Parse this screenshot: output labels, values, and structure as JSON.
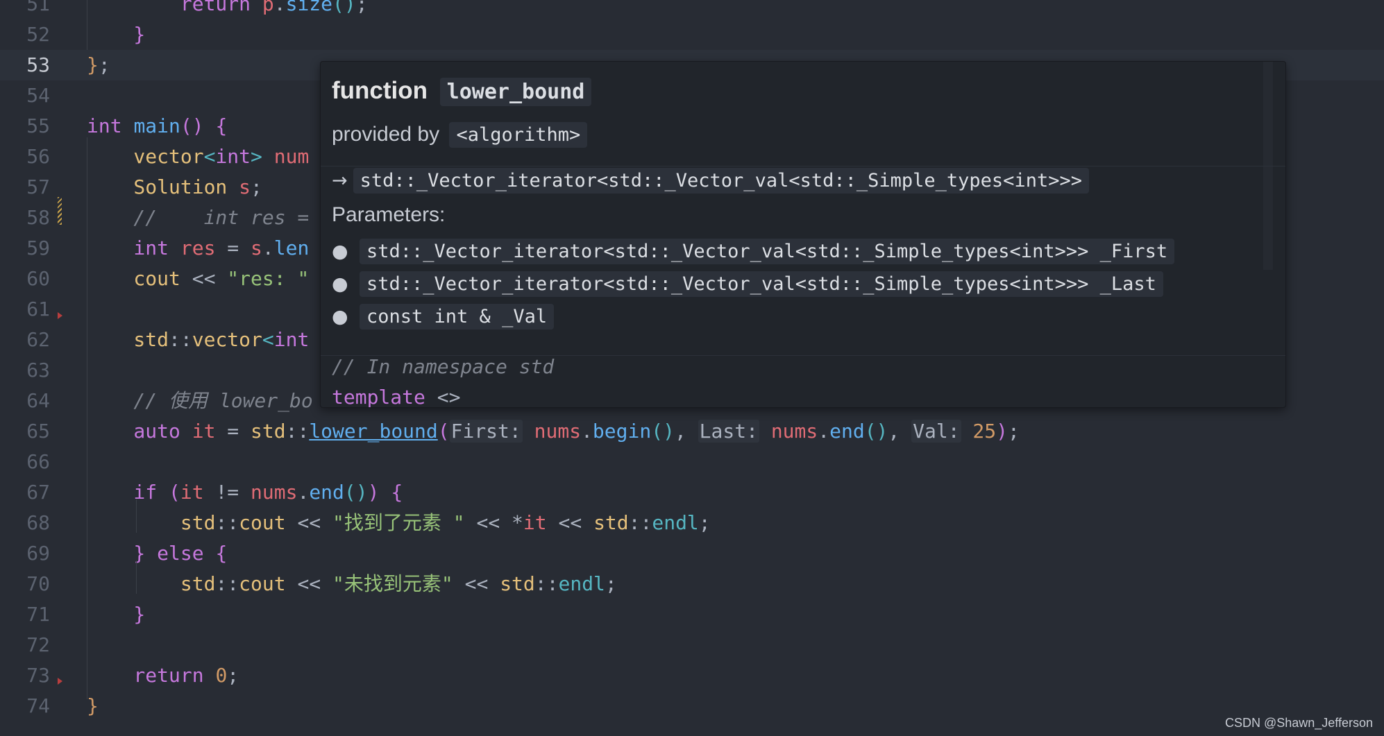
{
  "editor": {
    "lines": [
      {
        "n": "51",
        "parts": [
          [
            "kw",
            "        return "
          ],
          [
            "var",
            "p"
          ],
          [
            "op",
            "."
          ],
          [
            "fn",
            "size"
          ],
          [
            "br3",
            "()"
          ],
          [
            "op",
            ";"
          ]
        ]
      },
      {
        "n": "52",
        "parts": [
          [
            "br2",
            "    }"
          ]
        ]
      },
      {
        "n": "53",
        "current": true,
        "parts": [
          [
            "br1",
            "}"
          ],
          [
            "op",
            ";"
          ]
        ]
      },
      {
        "n": "54",
        "parts": []
      },
      {
        "n": "55",
        "parts": [
          [
            "kw",
            "int "
          ],
          [
            "fn",
            "main"
          ],
          [
            "br2",
            "()"
          ],
          [
            "op",
            " "
          ],
          [
            "br2",
            "{"
          ]
        ]
      },
      {
        "n": "56",
        "parts": [
          [
            "ty",
            "    vector"
          ],
          [
            "br3",
            "<"
          ],
          [
            "kw",
            "int"
          ],
          [
            "br3",
            "> "
          ],
          [
            "var",
            "num"
          ]
        ]
      },
      {
        "n": "57",
        "parts": [
          [
            "ty",
            "    Solution "
          ],
          [
            "var",
            "s"
          ],
          [
            "op",
            ";"
          ]
        ]
      },
      {
        "n": "58",
        "parts": [
          [
            "cm",
            "    //    int res ="
          ]
        ]
      },
      {
        "n": "59",
        "parts": [
          [
            "kw",
            "    int "
          ],
          [
            "var",
            "res"
          ],
          [
            "op",
            " = "
          ],
          [
            "var",
            "s"
          ],
          [
            "op",
            "."
          ],
          [
            "fn",
            "len"
          ]
        ]
      },
      {
        "n": "60",
        "parts": [
          [
            "ty",
            "    cout"
          ],
          [
            "op",
            " << "
          ],
          [
            "str",
            "\"res: \""
          ]
        ]
      },
      {
        "n": "61",
        "parts": []
      },
      {
        "n": "62",
        "parts": [
          [
            "ty",
            "    std"
          ],
          [
            "op",
            "::"
          ],
          [
            "ty",
            "vector"
          ],
          [
            "br3",
            "<"
          ],
          [
            "kw",
            "int"
          ]
        ]
      },
      {
        "n": "63",
        "parts": []
      },
      {
        "n": "64",
        "parts": [
          [
            "cm",
            "    // 使用 lower_bo"
          ]
        ]
      },
      {
        "n": "65",
        "parts": [
          [
            "kw",
            "    auto "
          ],
          [
            "var",
            "it"
          ],
          [
            "op",
            " = "
          ],
          [
            "ty",
            "std"
          ],
          [
            "op",
            "::"
          ],
          [
            "fnu",
            "lower_bound"
          ],
          [
            "br2",
            "("
          ],
          [
            "hint",
            "First:"
          ],
          [
            "op",
            " "
          ],
          [
            "var",
            "nums"
          ],
          [
            "op",
            "."
          ],
          [
            "fn",
            "begin"
          ],
          [
            "br3",
            "()"
          ],
          [
            "op",
            ", "
          ],
          [
            "hint",
            "Last:"
          ],
          [
            "op",
            " "
          ],
          [
            "var",
            "nums"
          ],
          [
            "op",
            "."
          ],
          [
            "fn",
            "end"
          ],
          [
            "br3",
            "()"
          ],
          [
            "op",
            ", "
          ],
          [
            "hint",
            "Val:"
          ],
          [
            "op",
            " "
          ],
          [
            "num",
            "25"
          ],
          [
            "br2",
            ")"
          ],
          [
            "op",
            ";"
          ]
        ]
      },
      {
        "n": "66",
        "parts": []
      },
      {
        "n": "67",
        "parts": [
          [
            "kw",
            "    if "
          ],
          [
            "br2",
            "("
          ],
          [
            "var",
            "it"
          ],
          [
            "op",
            " != "
          ],
          [
            "var",
            "nums"
          ],
          [
            "op",
            "."
          ],
          [
            "fn",
            "end"
          ],
          [
            "br3",
            "()"
          ],
          [
            "br2",
            ")"
          ],
          [
            "op",
            " "
          ],
          [
            "br2",
            "{"
          ]
        ]
      },
      {
        "n": "68",
        "parts": [
          [
            "ty",
            "        std"
          ],
          [
            "op",
            "::"
          ],
          [
            "ty",
            "cout"
          ],
          [
            "op",
            " << "
          ],
          [
            "str",
            "\"找到了元素 \""
          ],
          [
            "op",
            " << *"
          ],
          [
            "var",
            "it"
          ],
          [
            "op",
            " << "
          ],
          [
            "ty",
            "std"
          ],
          [
            "op",
            "::"
          ],
          [
            "cyan",
            "endl"
          ],
          [
            "op",
            ";"
          ]
        ]
      },
      {
        "n": "69",
        "parts": [
          [
            "br2",
            "    }"
          ],
          [
            "kw",
            " else "
          ],
          [
            "br2",
            "{"
          ]
        ]
      },
      {
        "n": "70",
        "parts": [
          [
            "ty",
            "        std"
          ],
          [
            "op",
            "::"
          ],
          [
            "ty",
            "cout"
          ],
          [
            "op",
            " << "
          ],
          [
            "str",
            "\"未找到元素\""
          ],
          [
            "op",
            " << "
          ],
          [
            "ty",
            "std"
          ],
          [
            "op",
            "::"
          ],
          [
            "cyan",
            "endl"
          ],
          [
            "op",
            ";"
          ]
        ]
      },
      {
        "n": "71",
        "parts": [
          [
            "br2",
            "    }"
          ]
        ]
      },
      {
        "n": "72",
        "parts": []
      },
      {
        "n": "73",
        "parts": [
          [
            "kw",
            "    return "
          ],
          [
            "num",
            "0"
          ],
          [
            "op",
            ";"
          ]
        ]
      },
      {
        "n": "74",
        "parts": [
          [
            "br1",
            "}"
          ]
        ]
      }
    ]
  },
  "hover": {
    "kind": "function",
    "name": "lower_bound",
    "provided_by_label": "provided by",
    "provided_by": "<algorithm>",
    "return_arrow": "→",
    "return_type": "std::_Vector_iterator<std::_Vector_val<std::_Simple_types<int>>>",
    "parameters_label": "Parameters:",
    "parameters": [
      "std::_Vector_iterator<std::_Vector_val<std::_Simple_types<int>>> _First",
      "std::_Vector_iterator<std::_Vector_val<std::_Simple_types<int>>> _Last",
      "const int & _Val"
    ],
    "code_comment": "// In namespace std",
    "code_template_kw": "template",
    "code_template_args": " <>"
  },
  "watermark": "CSDN @Shawn_Jefferson",
  "icons": {
    "fold": "fold-marker-icon",
    "modified": "modified-marker-icon",
    "bullet": "bullet-icon"
  }
}
